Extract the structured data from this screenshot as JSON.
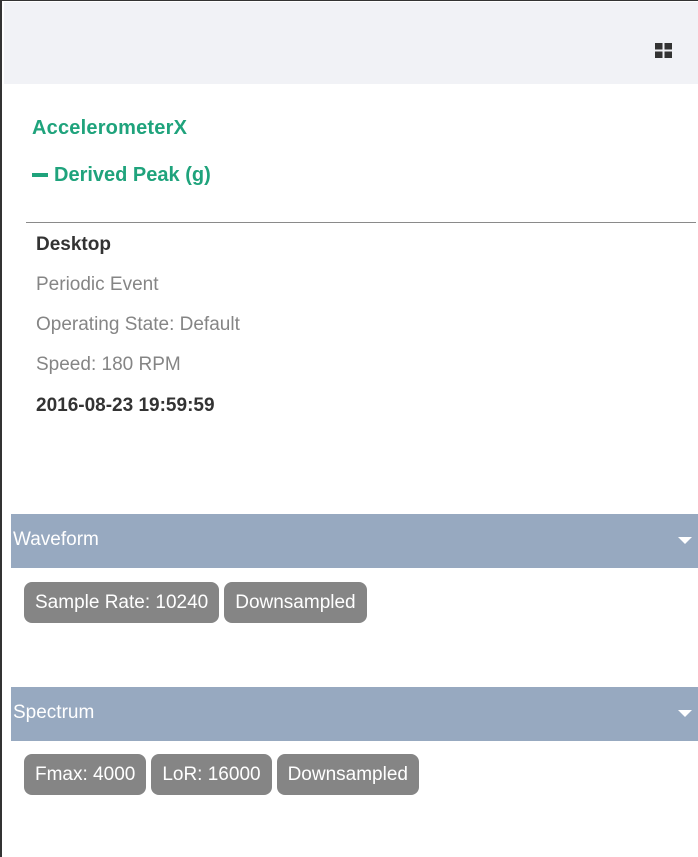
{
  "toolbar": {
    "icon": "grid-icon"
  },
  "sensor": {
    "name": "AccelerometerX",
    "measurement_label": "Derived Peak (g)",
    "toggle_icon": "minus-icon"
  },
  "details": {
    "location": "Desktop",
    "event_type": "Periodic Event",
    "operating_state": "Operating State: Default",
    "speed": "Speed: 180 RPM",
    "timestamp": "2016-08-23 19:59:59"
  },
  "waveform": {
    "title": "Waveform",
    "tags": [
      "Sample Rate: 10240",
      "Downsampled"
    ]
  },
  "spectrum": {
    "title": "Spectrum",
    "tags": [
      "Fmax: 4000",
      "LoR: 16000",
      "Downsampled"
    ]
  },
  "colors": {
    "accent_green": "#1fa37c",
    "section_header": "#97a9c0",
    "tag_bg": "#858585",
    "toolbar_bg": "#f1f2f6"
  }
}
